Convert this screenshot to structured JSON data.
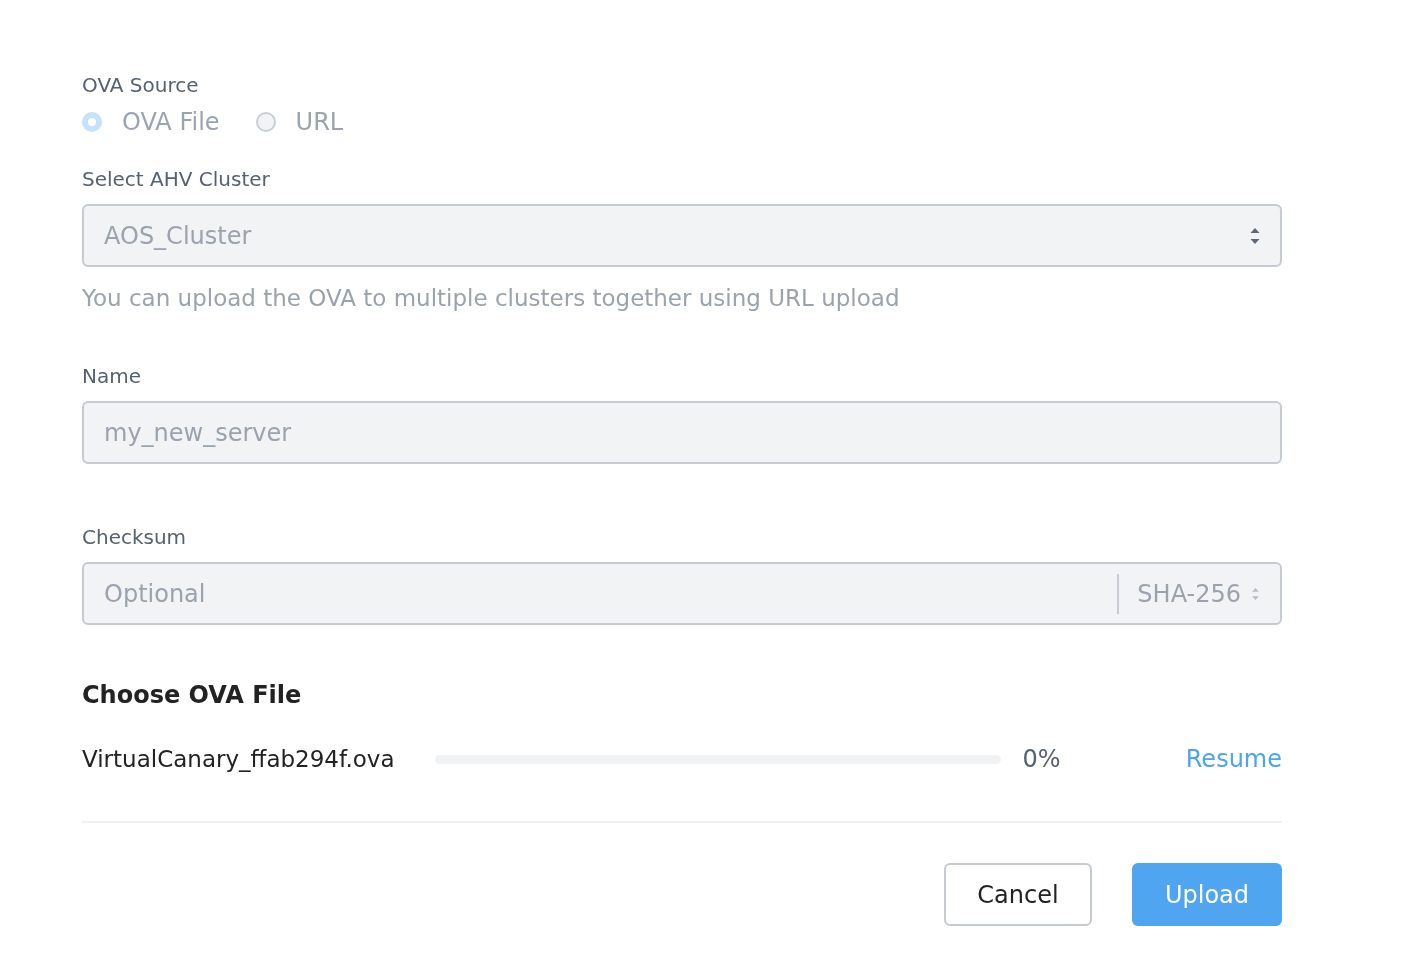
{
  "source": {
    "label": "OVA Source",
    "options": [
      {
        "label": "OVA File",
        "selected": true,
        "disabled": true
      },
      {
        "label": "URL",
        "selected": false,
        "disabled": true
      }
    ]
  },
  "cluster": {
    "label": "Select AHV Cluster",
    "value": "AOS_Cluster",
    "disabled": true,
    "hint": "You can upload the OVA to multiple clusters together using URL upload"
  },
  "name": {
    "label": "Name",
    "value": "my_new_server",
    "disabled": true
  },
  "checksum": {
    "label": "Checksum",
    "placeholder": "Optional",
    "algorithm": "SHA-256",
    "disabled": true
  },
  "file_section": {
    "title": "Choose OVA File",
    "file_name": "VirtualCanary_ffab294f.ova",
    "level": 0,
    "percent": "0%",
    "action": "Resume"
  },
  "buttons": [
    {
      "label": "Cancel",
      "kind": "secondary"
    },
    {
      "label": "Upload",
      "kind": "primary"
    }
  ]
}
